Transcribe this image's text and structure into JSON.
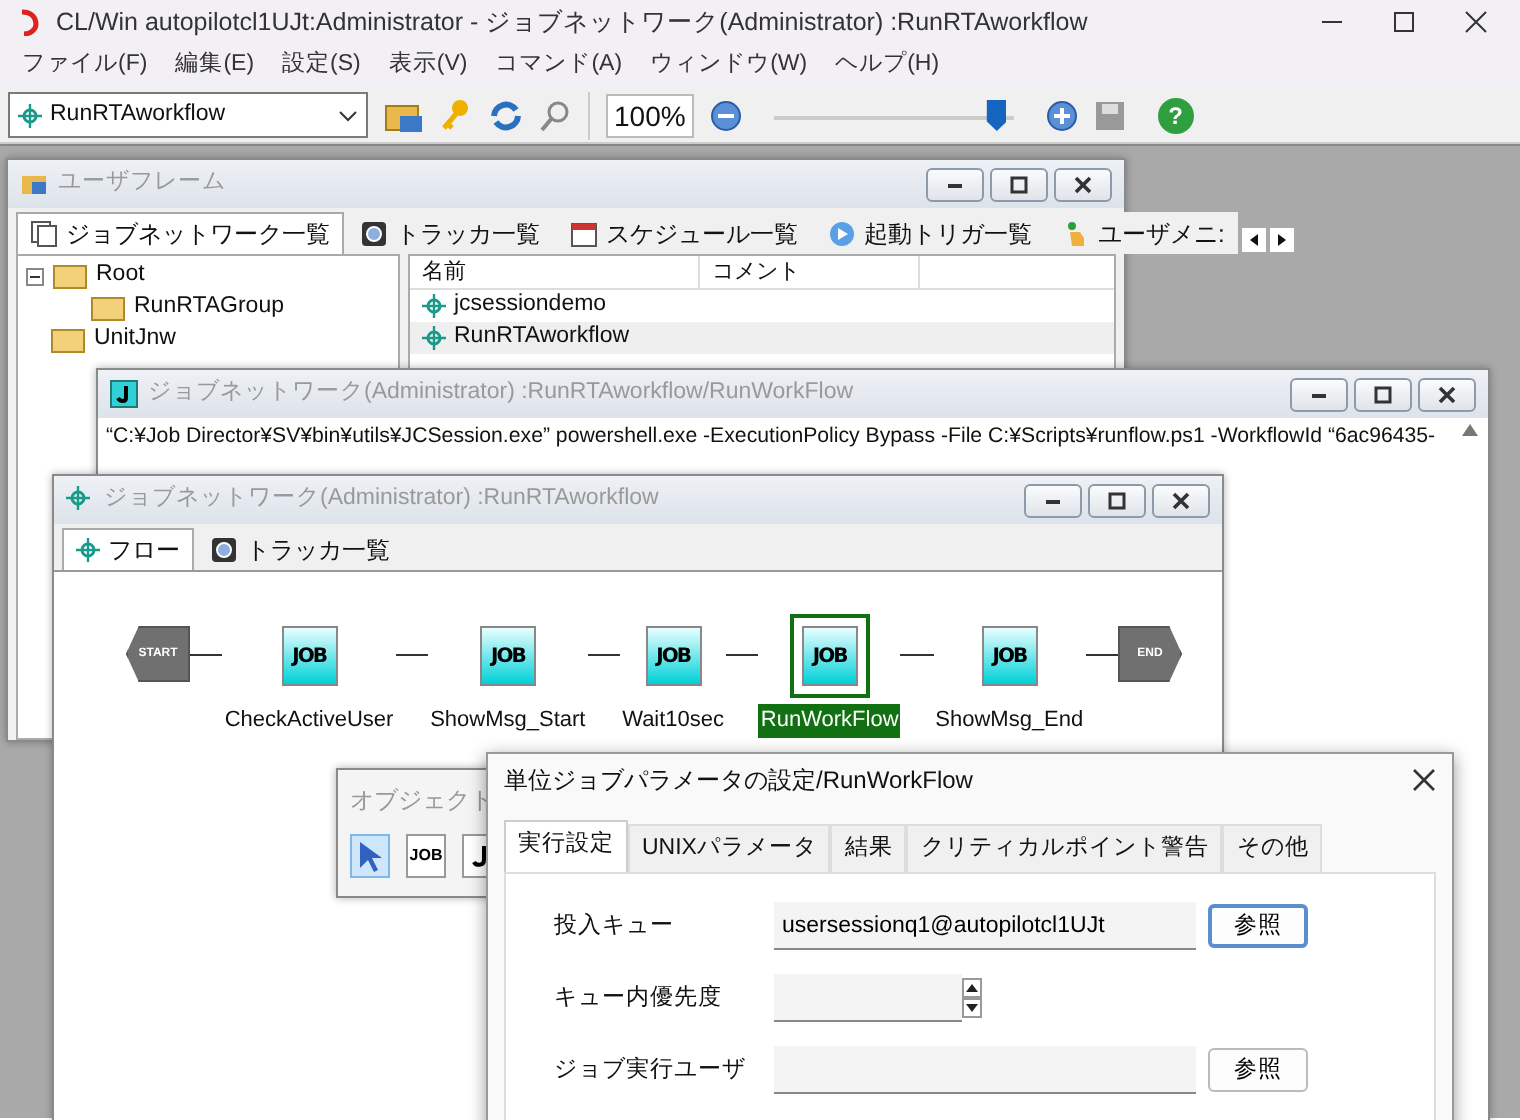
{
  "app": {
    "title": "CL/Win autopilotcl1UJt:Administrator - ジョブネットワーク(Administrator) :RunRTAworkflow",
    "menu": [
      "ファイル(F)",
      "編集(E)",
      "設定(S)",
      "表示(V)",
      "コマンド(A)",
      "ウィンドウ(W)",
      "ヘルプ(H)"
    ],
    "toolbar": {
      "network_select": "RunRTAworkflow",
      "zoom_text": "100%",
      "level": 0.93,
      "help_label": "?"
    }
  },
  "user_frame": {
    "title": "ユーザフレーム",
    "tabs": [
      {
        "kind": "network",
        "label": "ジョブネットワーク一覧",
        "selected": true
      },
      {
        "kind": "tracker",
        "label": "トラッカ一覧",
        "selected": false
      },
      {
        "kind": "schedule",
        "label": "スケジュール一覧",
        "selected": false
      },
      {
        "kind": "trigger",
        "label": "起動トリガ一覧",
        "selected": false
      },
      {
        "kind": "usermenu",
        "label": "ユーザメニ:",
        "selected": false
      }
    ],
    "tree": [
      {
        "label": "Root",
        "expanded": true,
        "children": [
          {
            "label": "RunRTAGroup"
          }
        ]
      },
      {
        "label": "UnitJnw"
      }
    ],
    "list": {
      "columns": [
        "名前",
        "コメント"
      ],
      "rows": [
        {
          "name": "jcsessiondemo",
          "selected": false
        },
        {
          "name": "RunRTAworkflow",
          "selected": true
        }
      ]
    }
  },
  "command_window": {
    "title": "ジョブネットワーク(Administrator) :RunRTAworkflow/RunWorkFlow",
    "command": "“C:¥Job Director¥SV¥bin¥utils¥JCSession.exe” powershell.exe -ExecutionPolicy Bypass -File C:¥Scripts¥runflow.ps1 -WorkflowId “6ac96435-"
  },
  "flow_window": {
    "title": "ジョブネットワーク(Administrator) :RunRTAworkflow",
    "tabs": [
      {
        "kind": "flow",
        "label": "フロー",
        "selected": true
      },
      {
        "kind": "tracker",
        "label": "トラッカ一覧",
        "selected": false
      }
    ],
    "nodes": [
      {
        "kind": "start",
        "icon_text": "START"
      },
      {
        "kind": "job",
        "icon_text": "JOB",
        "label": "CheckActiveUser",
        "selected": false
      },
      {
        "kind": "job",
        "icon_text": "JOB",
        "label": "ShowMsg_Start",
        "selected": false
      },
      {
        "kind": "job",
        "icon_text": "JOB",
        "label": "Wait10sec",
        "selected": false
      },
      {
        "kind": "job",
        "icon_text": "JOB",
        "label": "RunWorkFlow",
        "selected": true
      },
      {
        "kind": "job",
        "icon_text": "JOB",
        "label": "ShowMsg_End",
        "selected": false
      },
      {
        "kind": "end",
        "icon_text": "END"
      }
    ]
  },
  "object_palette": {
    "title": "オブジェクト",
    "tools": [
      {
        "kind": "pointer",
        "selected": true
      },
      {
        "kind": "job",
        "icon_text": "JOB",
        "selected": false
      },
      {
        "kind": "other",
        "selected": false
      }
    ]
  },
  "dialog": {
    "title": "単位ジョブパラメータの設定/RunWorkFlow",
    "tabs": [
      {
        "label": "実行設定",
        "selected": true
      },
      {
        "label": "UNIXパラメータ",
        "selected": false
      },
      {
        "label": "結果",
        "selected": false
      },
      {
        "label": "クリティカルポイント警告",
        "selected": false
      },
      {
        "label": "その他",
        "selected": false
      }
    ],
    "fields": [
      {
        "kind": "text",
        "label": "投入キュー",
        "value": "usersessionq1@autopilotcl1UJt",
        "button": "参照",
        "default": true
      },
      {
        "kind": "spin",
        "label": "キュー内優先度"
      },
      {
        "kind": "text",
        "label": "ジョブ実行ユーザ",
        "button": "参照",
        "default": false
      }
    ]
  }
}
